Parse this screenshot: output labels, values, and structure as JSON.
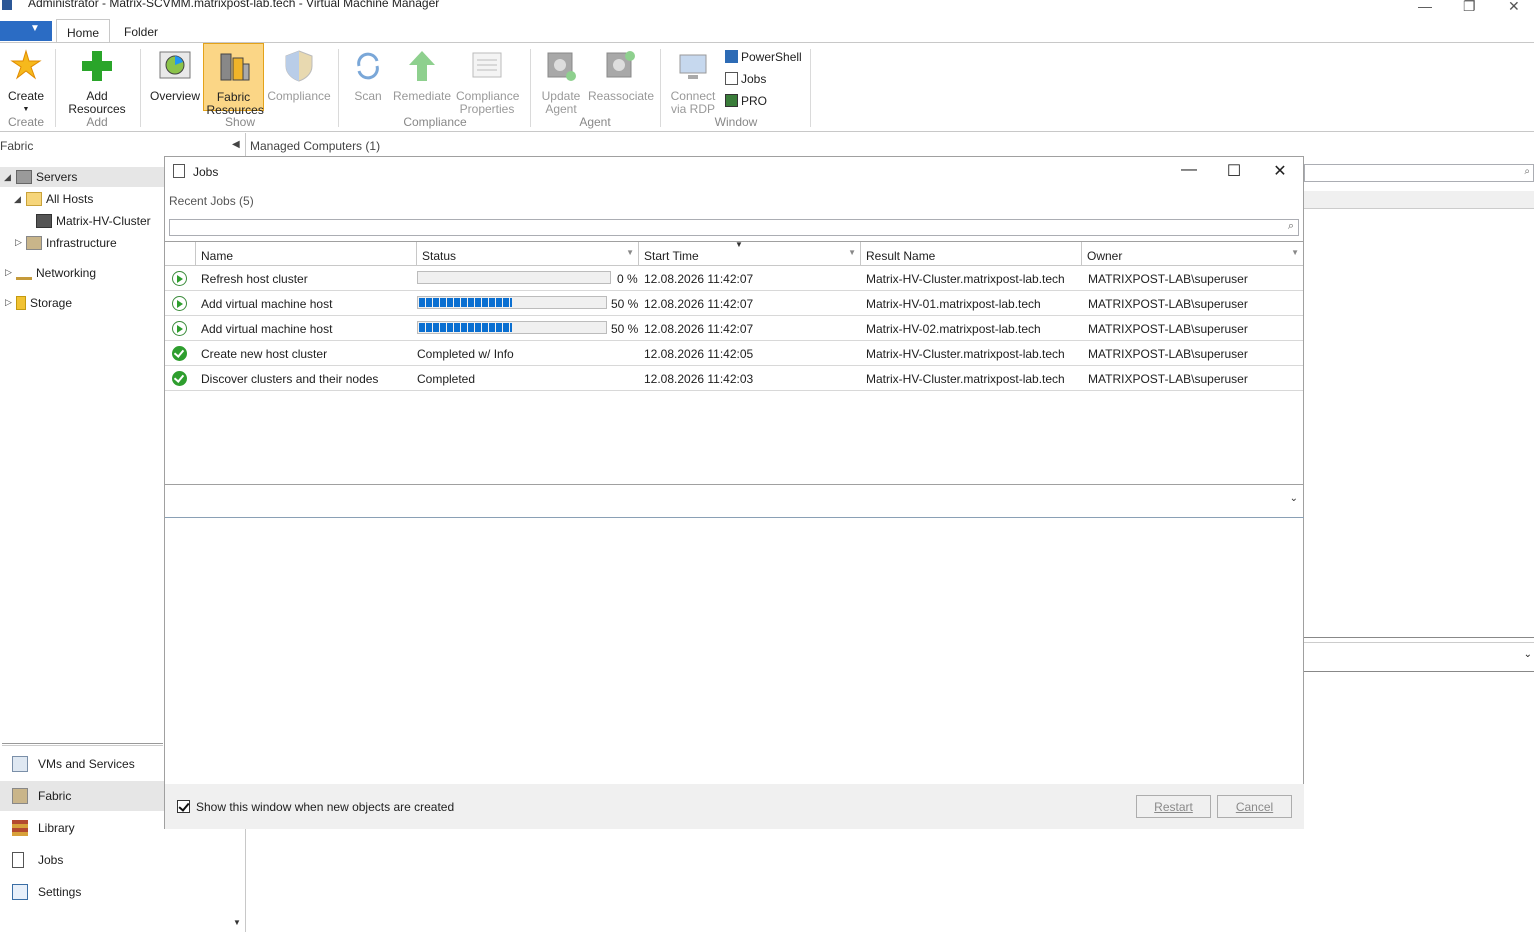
{
  "window": {
    "title": "Administrator - Matrix-SCVMM.matrixpost-lab.tech - Virtual Machine Manager",
    "controls": [
      "minimize",
      "restore",
      "close"
    ]
  },
  "ribbon": {
    "tabs": [
      "Home",
      "Folder"
    ],
    "active_tab": "Home",
    "groups": {
      "create": {
        "label": "Create",
        "buttons": [
          {
            "label": "Create",
            "icon": "create-star-icon"
          }
        ]
      },
      "add": {
        "label": "Add",
        "buttons": [
          {
            "label": "Add Resources",
            "icon": "add-plus-icon"
          }
        ]
      },
      "show": {
        "label": "Show",
        "buttons": [
          {
            "label": "Overview",
            "icon": "overview-chart-icon"
          },
          {
            "label": "Fabric Resources",
            "icon": "fabric-resources-icon",
            "selected": true
          },
          {
            "label": "Compliance",
            "icon": "compliance-shield-icon",
            "disabled": true
          }
        ]
      },
      "compliance": {
        "label": "Compliance",
        "buttons": [
          {
            "label": "Scan",
            "icon": "scan-icon",
            "disabled": true
          },
          {
            "label": "Remediate",
            "icon": "remediate-arrow-icon",
            "disabled": true
          },
          {
            "label": "Compliance Properties",
            "icon": "compliance-properties-icon",
            "disabled": true
          }
        ]
      },
      "agent": {
        "label": "Agent",
        "buttons": [
          {
            "label": "Update Agent",
            "icon": "update-agent-icon",
            "disabled": true
          },
          {
            "label": "Reassociate",
            "icon": "reassociate-icon",
            "disabled": true
          }
        ]
      },
      "window": {
        "label": "Window",
        "buttons": [
          {
            "label": "Connect via RDP",
            "icon": "rdp-icon",
            "disabled": true
          },
          {
            "label": "PowerShell",
            "icon": "powershell-icon"
          },
          {
            "label": "Jobs",
            "icon": "jobs-icon"
          },
          {
            "label": "PRO",
            "icon": "pro-icon"
          }
        ]
      }
    }
  },
  "left_pane": {
    "header": "Fabric",
    "tree": [
      {
        "label": "Servers",
        "icon": "servers-icon"
      },
      {
        "label": "All Hosts",
        "icon": "folder-icon"
      },
      {
        "label": "Matrix-HV-Cluster",
        "icon": "cluster-icon"
      },
      {
        "label": "Infrastructure",
        "icon": "infrastructure-icon"
      },
      {
        "label": "Networking",
        "icon": "networking-icon"
      },
      {
        "label": "Storage",
        "icon": "storage-icon"
      }
    ],
    "nav": [
      {
        "label": "VMs and Services",
        "icon": "vms-services-icon"
      },
      {
        "label": "Fabric",
        "icon": "fabric-icon",
        "selected": true
      },
      {
        "label": "Library",
        "icon": "library-icon"
      },
      {
        "label": "Jobs",
        "icon": "jobs-icon"
      },
      {
        "label": "Settings",
        "icon": "settings-icon"
      }
    ]
  },
  "main": {
    "header": "Managed Computers (1)"
  },
  "jobs_dialog": {
    "title": "Jobs",
    "recent_label": "Recent Jobs (5)",
    "search_placeholder": "",
    "columns": [
      "Name",
      "Status",
      "Start Time",
      "Result Name",
      "Owner"
    ],
    "rows": [
      {
        "state": "running",
        "name": "Refresh host cluster",
        "status_text": "",
        "progress": 0,
        "progress_label": "0 %",
        "start_time": "12.08.2026 11:42:07",
        "result_name": "Matrix-HV-Cluster.matrixpost-lab.tech",
        "owner": "MATRIXPOST-LAB\\superuser"
      },
      {
        "state": "running",
        "name": "Add virtual machine host",
        "status_text": "",
        "progress": 50,
        "progress_label": "50 %",
        "start_time": "12.08.2026 11:42:07",
        "result_name": "Matrix-HV-01.matrixpost-lab.tech",
        "owner": "MATRIXPOST-LAB\\superuser"
      },
      {
        "state": "running",
        "name": "Add virtual machine host",
        "status_text": "",
        "progress": 50,
        "progress_label": "50 %",
        "start_time": "12.08.2026 11:42:07",
        "result_name": "Matrix-HV-02.matrixpost-lab.tech",
        "owner": "MATRIXPOST-LAB\\superuser"
      },
      {
        "state": "completed",
        "name": "Create new host cluster",
        "status_text": "Completed w/ Info",
        "progress": null,
        "progress_label": "",
        "start_time": "12.08.2026 11:42:05",
        "result_name": "Matrix-HV-Cluster.matrixpost-lab.tech",
        "owner": "MATRIXPOST-LAB\\superuser"
      },
      {
        "state": "completed",
        "name": "Discover clusters and their nodes",
        "status_text": "Completed",
        "progress": null,
        "progress_label": "",
        "start_time": "12.08.2026 11:42:03",
        "result_name": "Matrix-HV-Cluster.matrixpost-lab.tech",
        "owner": "MATRIXPOST-LAB\\superuser"
      }
    ],
    "show_window_checkbox": {
      "label": "Show this window when new objects are created",
      "checked": true
    },
    "buttons": {
      "restart": "Restart",
      "cancel": "Cancel"
    }
  },
  "colors": {
    "accent": "#2b6cc4",
    "selected_ribbon": "#fbd686",
    "progress": "#0a6fd1",
    "success": "#2e9e2e"
  }
}
